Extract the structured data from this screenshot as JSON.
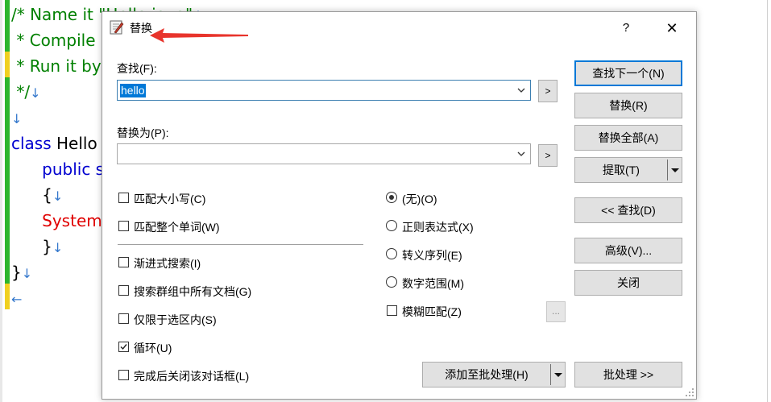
{
  "editor": {
    "lines": [
      {
        "text": "/* Name it \"Hello.java\"",
        "cls": "c-green",
        "ws": "↓"
      },
      {
        "text": " * Compile it",
        "cls": "c-green",
        "ws": ""
      },
      {
        "text": " * Run it by",
        "cls": "c-green",
        "ws": ""
      },
      {
        "text": " */",
        "cls": "c-green",
        "ws": "↓"
      },
      {
        "text": "",
        "cls": "c-black",
        "ws": "↓"
      },
      {
        "text": "class Hello {",
        "cls": "c-mixed",
        "ws": "↓"
      },
      {
        "text": "      public s",
        "cls": "c-blue",
        "ws": ""
      },
      {
        "text": "      {",
        "cls": "c-black",
        "ws": "↓"
      },
      {
        "text": "      System.",
        "cls": "c-red",
        "ws": ""
      },
      {
        "text": "      }",
        "cls": "c-black",
        "ws": "↓"
      },
      {
        "text": "}",
        "cls": "c-black",
        "ws": "↓"
      },
      {
        "text": "",
        "cls": "c-black",
        "ws": "←"
      }
    ]
  },
  "dialog": {
    "title": "替换",
    "help": "?",
    "close": "✕",
    "find_label": "查找(F):",
    "find_value": "hello",
    "replace_label": "替换为(P):",
    "replace_value": "",
    "more_btn": ">",
    "options_left": [
      {
        "label": "匹配大小写(C)",
        "checked": false
      },
      {
        "label": "匹配整个单词(W)",
        "checked": false
      },
      {
        "label": "渐进式搜索(I)",
        "checked": false
      },
      {
        "label": "搜索群组中所有文档(G)",
        "checked": false
      },
      {
        "label": "仅限于选区内(S)",
        "checked": false
      },
      {
        "label": "循环(U)",
        "checked": true
      },
      {
        "label": "完成后关闭该对话框(L)",
        "checked": false
      }
    ],
    "options_right": [
      {
        "label": "(无)(O)",
        "selected": true
      },
      {
        "label": "正则表达式(X)",
        "selected": false
      },
      {
        "label": "转义序列(E)",
        "selected": false
      },
      {
        "label": "数字范围(M)",
        "selected": false
      }
    ],
    "fuzzy_label": "模糊匹配(Z)",
    "fuzzy_checked": false,
    "dots_btn": "...",
    "buttons": {
      "find_next": "查找下一个(N)",
      "replace": "替换(R)",
      "replace_all": "替换全部(A)",
      "extract": "提取(T)",
      "find_back": "<< 查找(D)",
      "advanced": "高级(V)...",
      "close": "关闭",
      "add_batch": "添加至批处理(H)",
      "batch": "批处理 >>"
    }
  },
  "colors": {
    "accent": "#0078d7",
    "annotation_arrow": "#e8342c",
    "gutter_changed": "#2db52d",
    "gutter_unsaved": "#f0d020"
  }
}
